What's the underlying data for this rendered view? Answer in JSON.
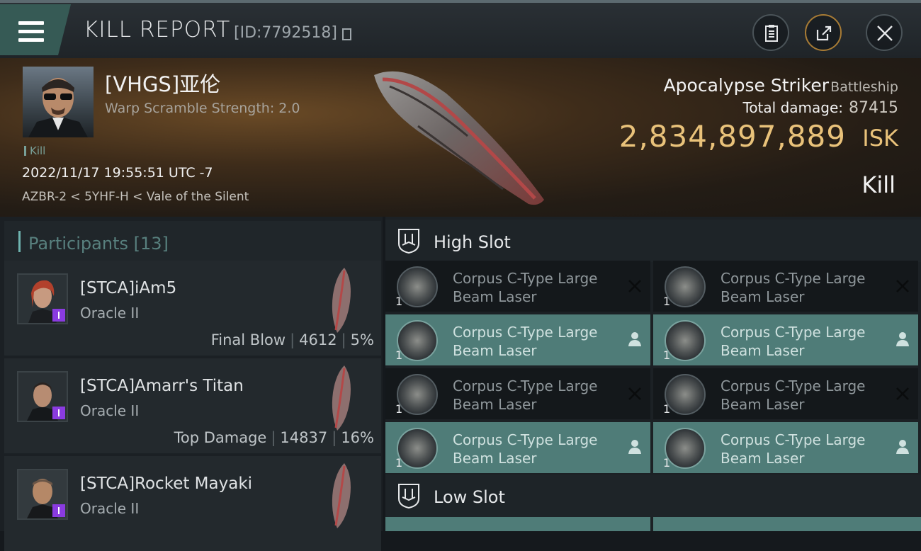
{
  "header": {
    "title": "KILL REPORT",
    "report_id": "[ID:7792518]"
  },
  "victim": {
    "name": "[VHGS]亚伦",
    "warp_scramble": "Warp Scramble Strength: 2.0",
    "tag": "Kill",
    "datetime": "2022/11/17 19:55:51 UTC -7",
    "location": "AZBR-2 < 5YHF-H < Vale of the Silent"
  },
  "ship": {
    "name": "Apocalypse Striker",
    "class": "Battleship",
    "total_damage_label": "Total damage:",
    "total_damage": "87415",
    "isk_value": "2,834,897,889",
    "isk_unit": "ISK",
    "result": "Kill"
  },
  "participants": {
    "label": "Participants",
    "count": "[13]",
    "items": [
      {
        "name": "[STCA]iAm5",
        "ship": "Oracle II",
        "role": "Final Blow",
        "damage": "4612",
        "percent": "5%"
      },
      {
        "name": "[STCA]Amarr's Titan",
        "ship": "Oracle II",
        "role": "Top Damage",
        "damage": "14837",
        "percent": "16%"
      },
      {
        "name": "[STCA]Rocket Mayaki",
        "ship": "Oracle II"
      }
    ]
  },
  "slots": {
    "high_label": "High Slot",
    "low_label": "Low Slot",
    "modules": [
      {
        "line1": "Corpus C-Type Large",
        "line2": "Beam Laser",
        "qty": "1",
        "status": "destroyed"
      },
      {
        "line1": "Corpus C-Type Large",
        "line2": "Beam Laser",
        "qty": "1",
        "status": "destroyed"
      },
      {
        "line1": "Corpus C-Type Large",
        "line2": "Beam Laser",
        "qty": "1",
        "status": "dropped"
      },
      {
        "line1": "Corpus C-Type Large",
        "line2": "Beam Laser",
        "qty": "1",
        "status": "dropped"
      },
      {
        "line1": "Corpus C-Type Large",
        "line2": "Beam Laser",
        "qty": "1",
        "status": "destroyed"
      },
      {
        "line1": "Corpus C-Type Large",
        "line2": "Beam Laser",
        "qty": "1",
        "status": "destroyed"
      },
      {
        "line1": "Corpus C-Type Large",
        "line2": "Beam Laser",
        "qty": "1",
        "status": "dropped"
      },
      {
        "line1": "Corpus C-Type Large",
        "line2": "Beam Laser",
        "qty": "1",
        "status": "dropped"
      }
    ]
  },
  "colors": {
    "accent": "#6fb4b0",
    "isk": "#e9c27a",
    "dropped_row": "#4f7c78",
    "destroyed_row": "#14181b"
  }
}
